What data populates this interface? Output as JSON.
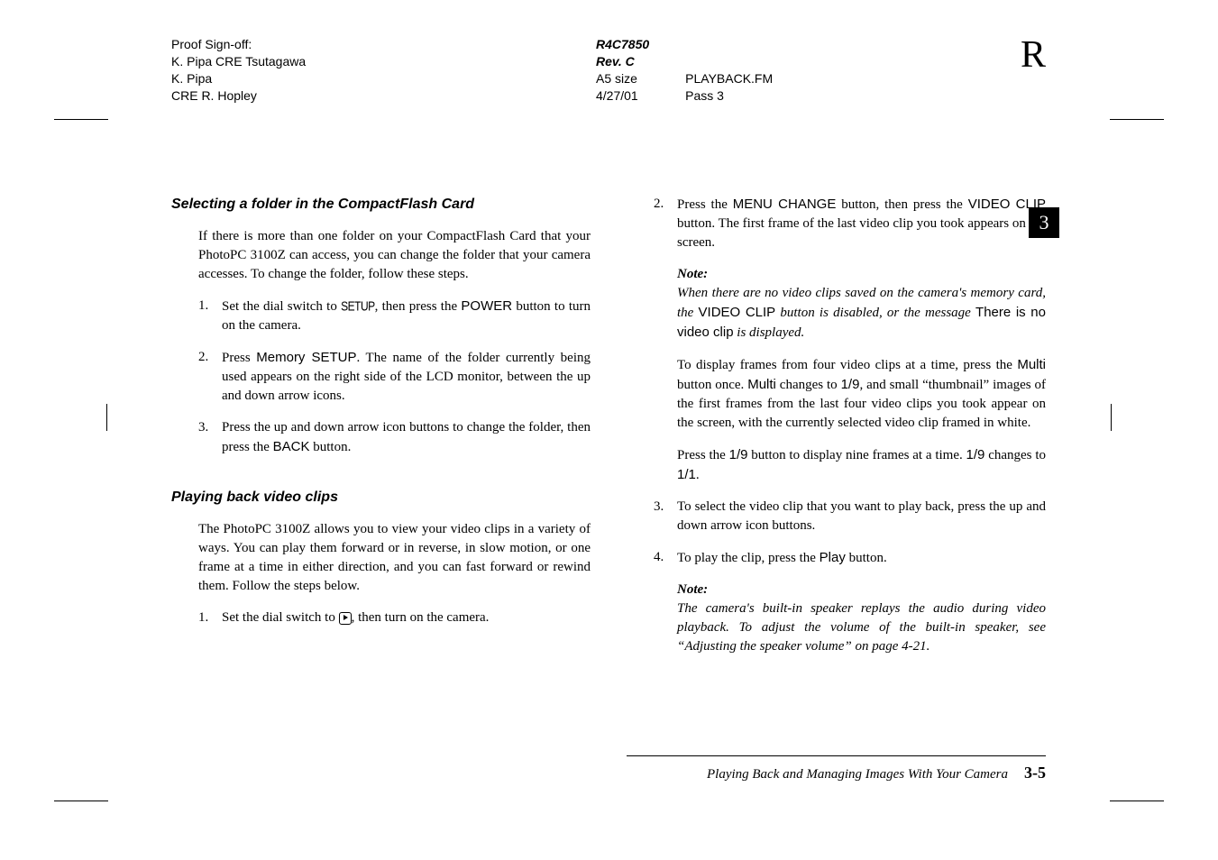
{
  "header": {
    "left": {
      "line1": "Proof Sign-off:",
      "line2": "K. Pipa CRE Tsutagawa",
      "line3": "K. Pipa",
      "line4": "CRE R. Hopley"
    },
    "center": {
      "doc_id": "R4C7850",
      "rev": "Rev. C",
      "size": "A5 size",
      "date": "4/27/01",
      "filename": "PLAYBACK.FM",
      "pass": "Pass 3"
    },
    "right": "R"
  },
  "tab": {
    "number": "3"
  },
  "left_col": {
    "heading1": "Selecting a folder in the CompactFlash Card",
    "p1": "If there is more than one folder on your CompactFlash Card that your PhotoPC 3100Z can access, you can change the folder that your camera accesses. To change the folder, follow these steps.",
    "step1": {
      "n": "1.",
      "pre": "Set the dial switch to ",
      "setup_label": "SETUP",
      "mid": ", then press the ",
      "power_label": "POWER",
      "post": " button to turn on the camera."
    },
    "step2": {
      "n": "2.",
      "pre": "Press ",
      "memory_label": "Memory SETUP",
      "post": ". The name of the folder currently being used appears on the right side of the LCD monitor, between the up and down arrow icons."
    },
    "step3": {
      "n": "3.",
      "pre": "Press the up and down arrow icon buttons to change the folder, then press the ",
      "back_label": "BACK",
      "post": " button."
    },
    "heading2": "Playing back video clips",
    "p2": "The PhotoPC 3100Z allows you to view your video clips in a variety of ways. You can play them forward or in reverse, in slow motion, or one frame at a time in either direction, and you can fast forward or rewind them. Follow the steps below.",
    "step_b1": {
      "n": "1.",
      "pre": "Set the dial switch to ",
      "post": ", then turn on the camera."
    }
  },
  "right_col": {
    "step2": {
      "n": "2.",
      "pre": "Press the ",
      "menuchange_label": "MENU CHANGE",
      "mid": " button, then press the ",
      "videoclip_label": "VIDEO CLIP",
      "post": " button. The first frame of the last video clip you took appears on the screen."
    },
    "note1": {
      "label": "Note:",
      "pre": "When there are no video clips saved on the camera's memory card, the ",
      "vc_label": "VIDEO CLIP",
      "mid": " button is disabled, or the message ",
      "novc_label": "There is no video clip",
      "post": " is displayed."
    },
    "para_a": {
      "pre": "To display frames from four video clips at a time, press the ",
      "multi_label": "Multi",
      "mid1": " button once. ",
      "multi_label2": "Multi",
      "mid2": " changes to ",
      "n19": "1/9",
      "post": ", and small “thumbnail” images of the first frames from the last four video clips you took appear on the screen, with the currently selected video clip framed in white."
    },
    "para_b": {
      "pre": "Press the ",
      "n19": "1/9",
      "mid1": " button to display nine frames at a time. ",
      "n19b": "1/9",
      "mid2": " changes to ",
      "n11": "1/1",
      "post": "."
    },
    "step3": {
      "n": "3.",
      "text": "To select the video clip that you want to play back, press the up and down arrow icon buttons."
    },
    "step4": {
      "n": "4.",
      "pre": "To play the clip, press the ",
      "play_label": "Play",
      "post": " button."
    },
    "note2": {
      "label": "Note:",
      "text": "The camera's built-in speaker replays the audio during video playback. To adjust the volume of the built-in speaker, see “Adjusting the speaker volume” on page 4-21."
    }
  },
  "footer": {
    "title": "Playing Back and Managing Images With Your Camera",
    "page": "3-5"
  }
}
